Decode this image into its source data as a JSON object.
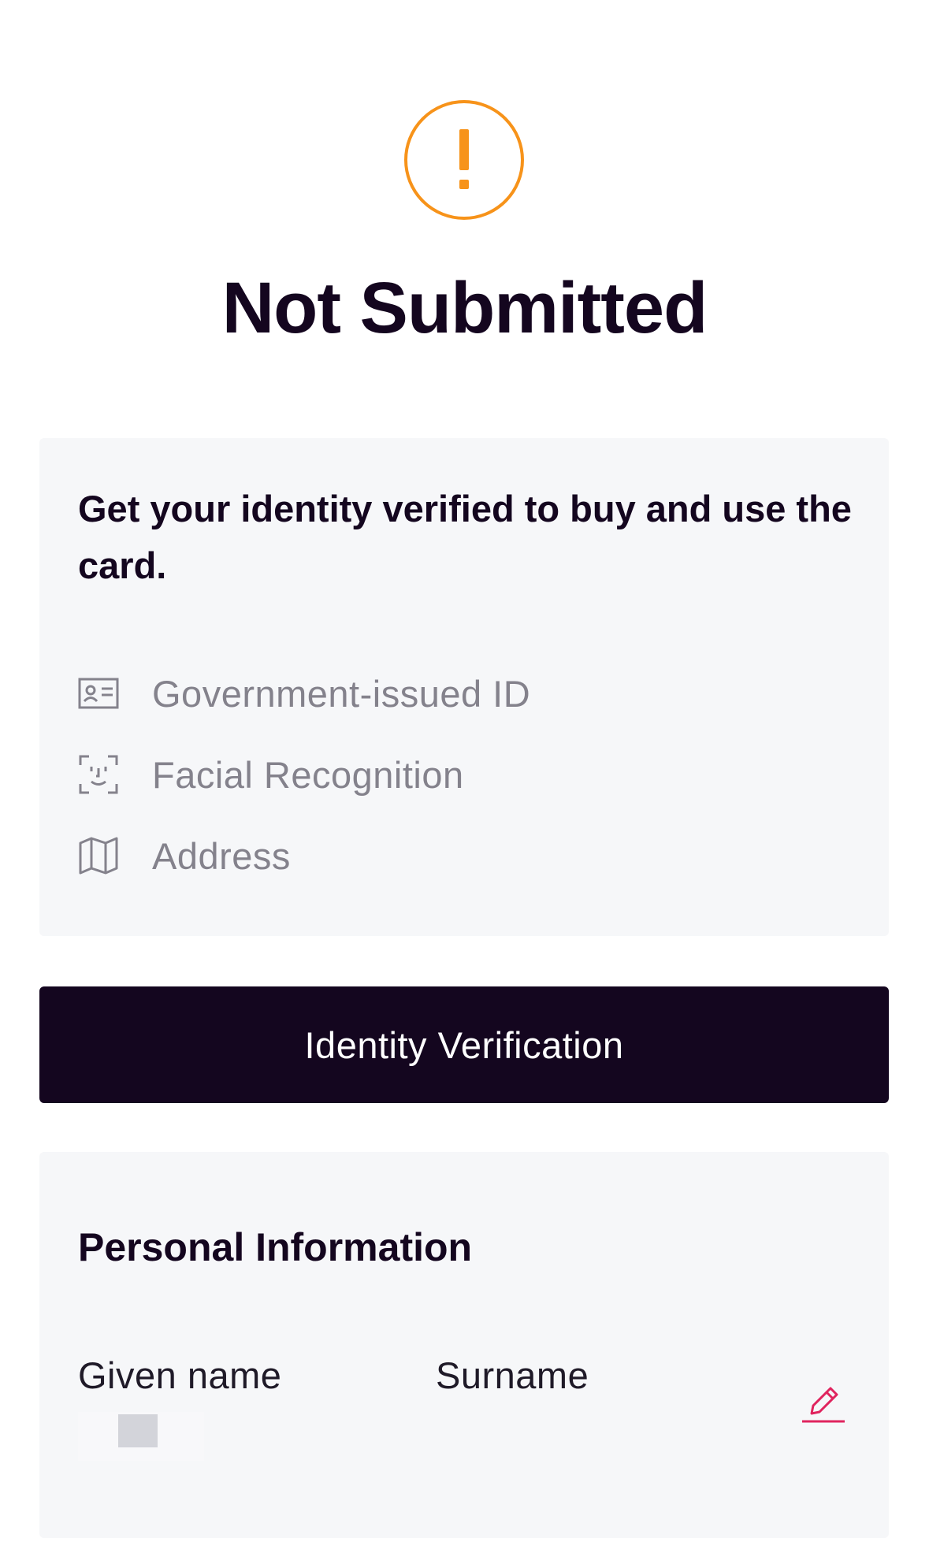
{
  "status": {
    "icon": "exclamation-circle-icon",
    "title": "Not Submitted",
    "accent_color": "#f7931a"
  },
  "info_card": {
    "heading": "Get your identity verified to buy and use the card.",
    "requirements": [
      {
        "icon": "id-card-icon",
        "label": "Government-issued ID"
      },
      {
        "icon": "face-scan-icon",
        "label": "Facial Recognition"
      },
      {
        "icon": "map-icon",
        "label": "Address"
      }
    ]
  },
  "verify_button": {
    "label": "Identity Verification",
    "color": "#14061f"
  },
  "personal_info": {
    "heading": "Personal Information",
    "given_name_label": "Given name",
    "surname_label": "Surname",
    "edit_icon": "pencil-icon",
    "edit_color": "#e0245e"
  }
}
